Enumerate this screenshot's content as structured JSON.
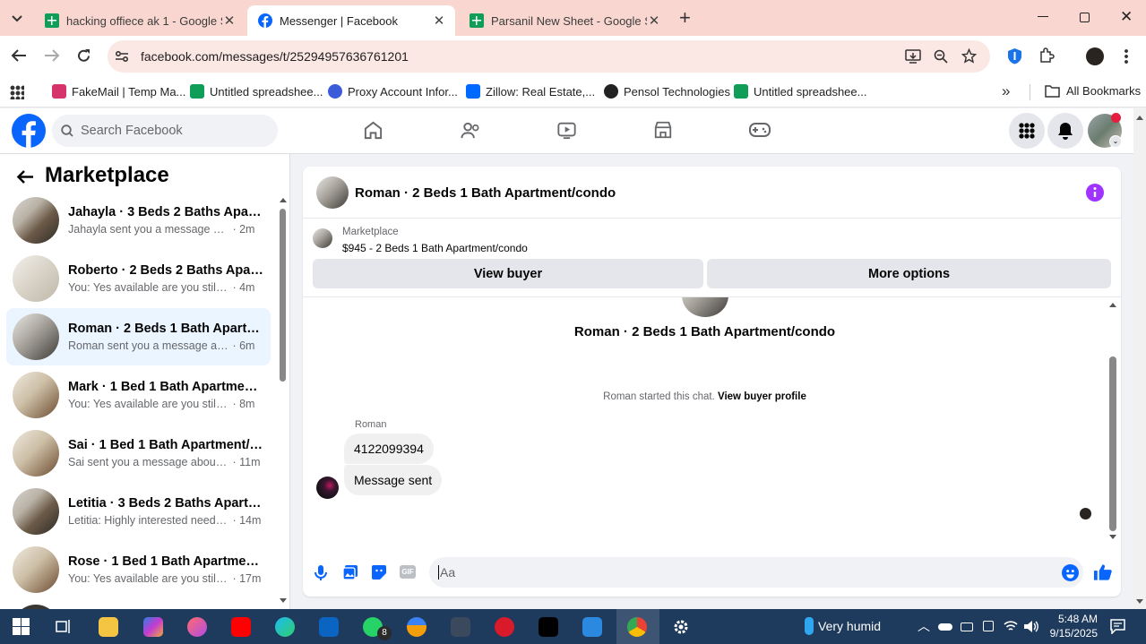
{
  "browser": {
    "tabs": [
      {
        "title": "hacking offiece ak 1 - Google Sh",
        "icon": "google-sheets-icon",
        "active": false
      },
      {
        "title": "Messenger | Facebook",
        "icon": "facebook-icon",
        "active": true
      },
      {
        "title": "Parsanil New Sheet - Google Sh",
        "icon": "google-sheets-icon",
        "active": false
      }
    ],
    "url": "facebook.com/messages/t/25294957636761201",
    "bookmarks": [
      {
        "label": "FakeMail | Temp Ma...",
        "icon": "fakemail-icon"
      },
      {
        "label": "Untitled spreadshee...",
        "icon": "google-sheets-icon"
      },
      {
        "label": "Proxy Account Infor...",
        "icon": "proxy-icon"
      },
      {
        "label": "Zillow: Real Estate,...",
        "icon": "zillow-icon"
      },
      {
        "label": "Pensol Technologies",
        "icon": "pensol-icon"
      },
      {
        "label": "Untitled spreadshee...",
        "icon": "google-sheets-icon"
      }
    ],
    "all_bookmarks": "All Bookmarks"
  },
  "facebook": {
    "search_placeholder": "Search Facebook",
    "nav_icons": [
      "home-icon",
      "friends-icon",
      "watch-icon",
      "marketplace-icon",
      "gaming-icon"
    ]
  },
  "sidebar": {
    "title": "Marketplace",
    "conversations": [
      {
        "name": "Jahayla · 3 Beds 2 Baths Apartm...",
        "snippet": "Jahayla sent you a message about ...",
        "time": "2m",
        "selected": false
      },
      {
        "name": "Roberto · 2 Beds 2 Baths Apart...",
        "snippet": "You: Yes available are you still inter...",
        "time": "4m",
        "selected": false
      },
      {
        "name": "Roman · 2 Beds 1 Bath Apartme...",
        "snippet": "Roman sent you a message about ...",
        "time": "6m",
        "selected": true
      },
      {
        "name": "Mark · 1 Bed 1 Bath Apartment/...",
        "snippet": "You: Yes available are you still inter...",
        "time": "8m",
        "selected": false
      },
      {
        "name": "Sai · 1 Bed 1 Bath Apartment/co...",
        "snippet": "Sai sent you a message about yo...",
        "time": "11m",
        "selected": false
      },
      {
        "name": "Letitia · 3 Beds 2 Baths Apartme...",
        "snippet": "Letitia: Highly interested need to ...",
        "time": "14m",
        "selected": false
      },
      {
        "name": "Rose · 1 Bed 1 Bath Apartment/c...",
        "snippet": "You: Yes available are you still int...",
        "time": "17m",
        "selected": false
      }
    ]
  },
  "chat": {
    "header_title": "Roman · 2 Beds 1 Bath Apartment/condo",
    "listing_source": "Marketplace",
    "listing_desc": "$945 - 2 Beds 1 Bath Apartment/condo",
    "view_buyer": "View buyer",
    "more_options": "More options",
    "intro_title": "Roman · 2 Beds 1 Bath Apartment/condo",
    "started_text": "Roman started this chat.",
    "view_buyer_profile": "View buyer profile",
    "sender_name": "Roman",
    "messages": [
      "4122099394",
      "Message sent"
    ],
    "composer_placeholder": "Aa"
  },
  "taskbar": {
    "weather": "Very humid",
    "time": "5:48 AM",
    "date": "9/15/2025",
    "whatsapp_badge": "8"
  },
  "colors": {
    "facebook_blue": "#0866ff",
    "selected_conv_bg": "#ebf5ff",
    "tab_strip": "#f9d7d0",
    "taskbar": "#1e3a5c"
  }
}
